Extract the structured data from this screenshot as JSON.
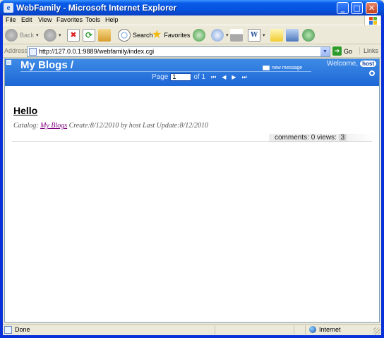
{
  "window": {
    "title": "WebFamily - Microsoft Internet Explorer"
  },
  "menu": {
    "items": [
      "File",
      "Edit",
      "View",
      "Favorites",
      "Tools",
      "Help"
    ]
  },
  "toolbar": {
    "back_label": "Back",
    "search_label": "Search",
    "favorites_label": "Favorites"
  },
  "address": {
    "label": "Address",
    "url": "http://127.0.0.1:9889/webfamily/index.cgi",
    "go_label": "Go",
    "links_label": "Links"
  },
  "blog": {
    "title": "My Blogs /",
    "new_message": "new message",
    "welcome": "Welcome,",
    "user": "host",
    "pager": {
      "page_label": "Page",
      "current": "1",
      "of_label": "of 1"
    }
  },
  "post": {
    "title": "Hello",
    "catalog_label": "Catalog:",
    "catalog_link": "My Blogs",
    "meta_text": "Create:8/12/2010 by host Last Update:8/12/2010",
    "comments_label": "comments:",
    "comments": "0",
    "views_label": "views:",
    "views": "3"
  },
  "status": {
    "text": "Done",
    "zone": "Internet"
  },
  "colors": {
    "titlebar": "#0a5ce8",
    "header": "#2a74de",
    "link_visited": "#800080"
  }
}
